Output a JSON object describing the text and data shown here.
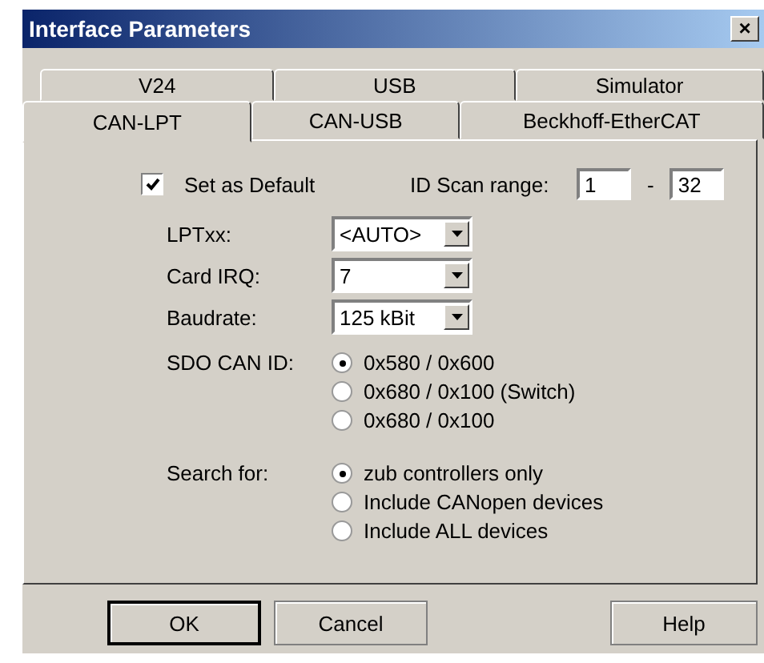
{
  "window": {
    "title": "Interface Parameters",
    "close": "×"
  },
  "tab_rows": [
    [
      {
        "label": "V24",
        "selected": false
      },
      {
        "label": "USB",
        "selected": false
      },
      {
        "label": "Simulator",
        "selected": false
      }
    ],
    [
      {
        "label": "CAN-LPT",
        "selected": true
      },
      {
        "label": "CAN-USB",
        "selected": false
      },
      {
        "label": "Beckhoff-EtherCAT",
        "selected": false
      }
    ]
  ],
  "set_as_default": {
    "label": "Set as Default",
    "checked": true
  },
  "id_scan_range": {
    "label": "ID Scan range:",
    "from": "1",
    "separator": "-",
    "to": "32"
  },
  "dropdowns": [
    {
      "label": "LPTxx:",
      "value": "<AUTO>"
    },
    {
      "label": "Card IRQ:",
      "value": "7"
    },
    {
      "label": "Baudrate:",
      "value": "125 kBit"
    }
  ],
  "radio_groups": [
    {
      "label": "SDO CAN ID:",
      "options": [
        {
          "label": "0x580 / 0x600",
          "selected": true
        },
        {
          "label": "0x680 / 0x100 (Switch)",
          "selected": false
        },
        {
          "label": "0x680 / 0x100",
          "selected": false
        }
      ]
    },
    {
      "label": "Search for:",
      "options": [
        {
          "label": "zub controllers only",
          "selected": true
        },
        {
          "label": "Include CANopen devices",
          "selected": false
        },
        {
          "label": "Include ALL devices",
          "selected": false
        }
      ]
    }
  ],
  "buttons": [
    {
      "label": "OK",
      "kind": "default"
    },
    {
      "label": "Cancel",
      "kind": "normal"
    },
    {
      "label": "Help",
      "kind": "help"
    }
  ]
}
